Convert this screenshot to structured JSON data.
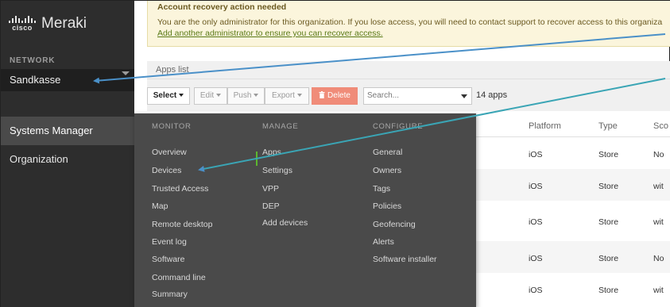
{
  "sidebar": {
    "logo_cisco": "cisco",
    "logo_brand": "Meraki",
    "network_label": "NETWORK",
    "network_name": "Sandkasse",
    "items": [
      {
        "label": "Systems Manager"
      },
      {
        "label": "Organization"
      }
    ]
  },
  "alert": {
    "title": "Account recovery action needed",
    "body": "You are the only administrator for this organization. If you lose access, you will need to contact support to recover access to this organiza",
    "link": "Add another administrator to ensure you can recover access."
  },
  "panel": {
    "title": "Apps list",
    "toolbar": {
      "select_label": "Select",
      "edit_label": "Edit",
      "push_label": "Push",
      "export_label": "Export",
      "delete_label": "Delete",
      "search_placeholder": "Search...",
      "apps_count": "14 apps"
    },
    "columns": [
      "Platform",
      "Type",
      "Sco"
    ],
    "rows": [
      {
        "platform": "iOS",
        "type": "Store",
        "scope": "No"
      },
      {
        "platform": "iOS",
        "type": "Store",
        "scope": "wit"
      },
      {
        "platform": "iOS",
        "type": "Store",
        "scope": "wit"
      },
      {
        "platform": "iOS",
        "type": "Store",
        "scope": "No"
      },
      {
        "platform": "iOS",
        "type": "Store",
        "scope": "wit"
      }
    ]
  },
  "menu": {
    "monitor_header": "MONITOR",
    "manage_header": "MANAGE",
    "configure_header": "CONFIGURE",
    "monitor": [
      "Overview",
      "Devices",
      "Trusted Access",
      "Map",
      "Remote desktop",
      "Event log",
      "Software",
      "Command line",
      "Summary"
    ],
    "manage": [
      "Apps",
      "Settings",
      "VPP",
      "DEP",
      "Add devices"
    ],
    "configure": [
      "General",
      "Owners",
      "Tags",
      "Policies",
      "Geofencing",
      "Alerts",
      "Software installer"
    ]
  },
  "colors": {
    "sidebar_bg": "#2d2d2d",
    "menu_bg": "#4a4a4a",
    "delete_btn": "#f08c79",
    "active_indicator": "#5cb82e",
    "alert_bg": "#fbf5dc",
    "arrow": "#4a90c8"
  }
}
